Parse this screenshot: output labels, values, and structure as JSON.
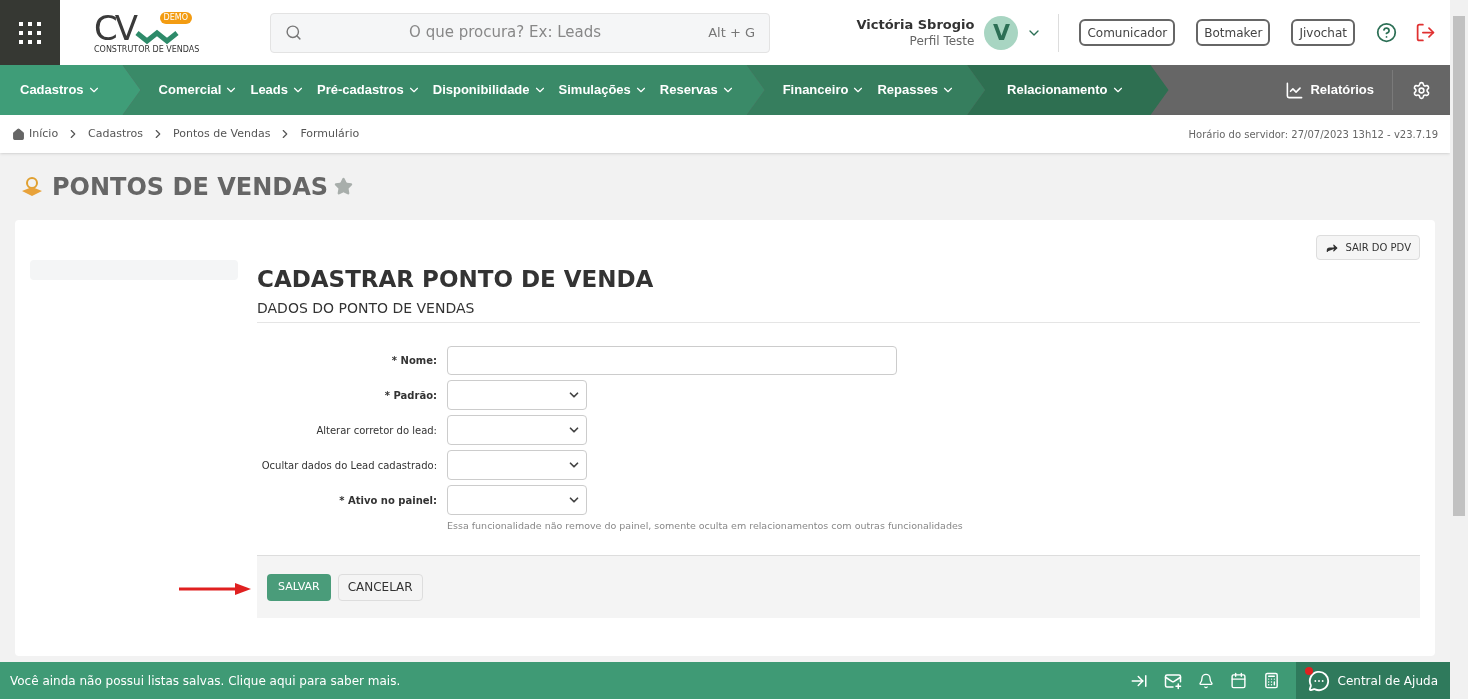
{
  "header": {
    "logo": {
      "letters": "CV",
      "badge": "DEMO",
      "tagline": "CONSTRUTOR DE VENDAS"
    },
    "search": {
      "placeholder": "O que procura? Ex: Leads",
      "shortcut": "Alt + G"
    },
    "user": {
      "name": "Victória Sbrogio",
      "profile": "Perfil Teste",
      "initial": "V"
    },
    "buttons": [
      "Comunicador",
      "Botmaker",
      "Jivochat"
    ]
  },
  "nav": {
    "groups": [
      {
        "color": "#3f9d78",
        "items": [
          "Cadastros"
        ]
      },
      {
        "color": "#3a8a68",
        "items": [
          "Comercial",
          "Leads",
          "Pré-cadastros",
          "Disponibilidade",
          "Simulações",
          "Reservas"
        ]
      },
      {
        "color": "#367e5e",
        "items": [
          "Financeiro",
          "Repasses"
        ]
      },
      {
        "color": "#2e6f51",
        "items": [
          "Relacionamento"
        ]
      }
    ],
    "reports": "Relatórios"
  },
  "breadcrumb": [
    "Início",
    "Cadastros",
    "Pontos de Vendas",
    "Formulário"
  ],
  "server_time": "Horário do servidor: 27/07/2023 13h12 - v23.7.19",
  "page_title": "PONTOS DE VENDAS",
  "exit_button": "SAIR DO PDV",
  "form": {
    "required_mark": "*",
    "title": "CADASTRAR PONTO DE VENDA",
    "section": "DADOS DO PONTO DE VENDAS",
    "fields": [
      {
        "kind": "text",
        "label": "Nome:",
        "required": true
      },
      {
        "kind": "select",
        "label": "Padrão:",
        "required": true
      },
      {
        "kind": "select",
        "label": "Alterar corretor do lead:",
        "required": false
      },
      {
        "kind": "select",
        "label": "Ocultar dados do Lead cadastrado:",
        "required": false
      },
      {
        "kind": "select",
        "label": "Ativo no painel:",
        "required": true,
        "help": "Essa funcionalidade não remove do painel, somente oculta em relacionamentos com outras funcionalidades"
      }
    ],
    "save": "SALVAR",
    "cancel": "CANCELAR"
  },
  "footer": {
    "message": "Você ainda não possui listas salvas. Clique aqui para saber mais.",
    "help": "Central de Ajuda"
  }
}
